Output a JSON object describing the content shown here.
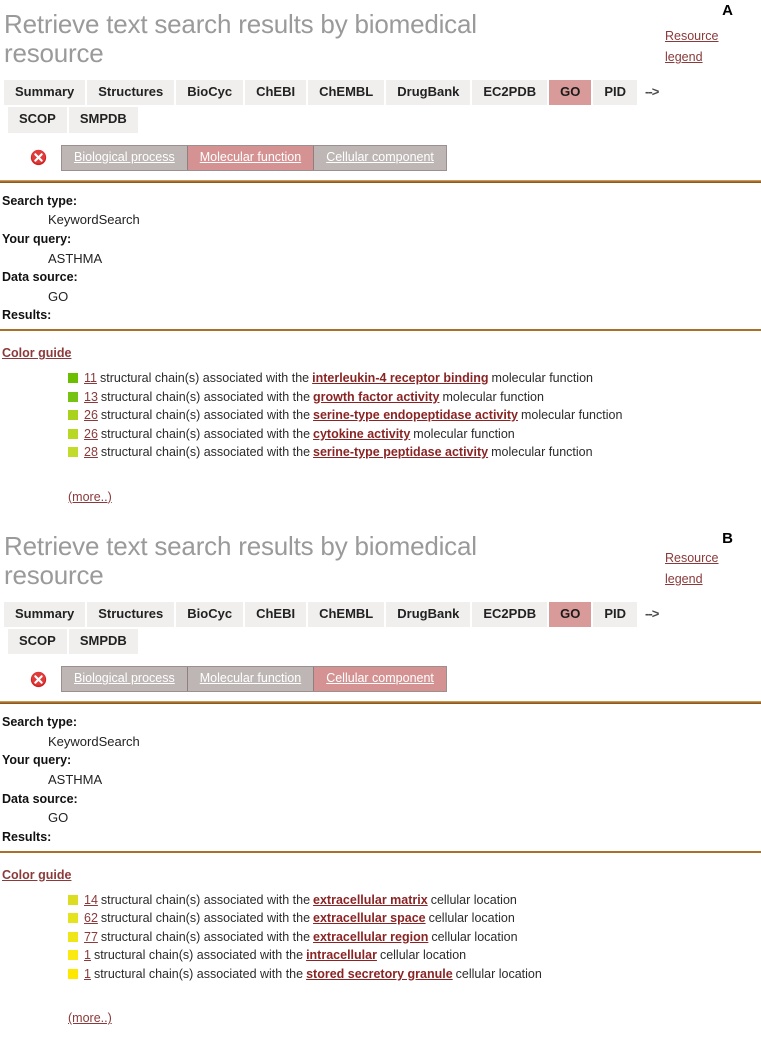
{
  "panels": [
    {
      "letter": "A",
      "title": "Retrieve text search results by biomedical resource",
      "resource_legend": {
        "line1": "Resource",
        "line2": "legend"
      },
      "resource_tabs": {
        "row1": [
          "Summary",
          "Structures",
          "BioCyc",
          "ChEBI",
          "ChEMBL",
          "DrugBank",
          "EC2PDB",
          "GO",
          "PID"
        ],
        "row2": [
          "SCOP",
          "SMPDB"
        ],
        "active": "GO",
        "arrow": "-->"
      },
      "subtabs": {
        "items": [
          "Biological process",
          "Molecular function",
          "Cellular component"
        ],
        "active": "Molecular function",
        "close_icon": "close-circle-icon"
      },
      "meta": {
        "search_type_label": "Search type:",
        "search_type_value": "KeywordSearch",
        "query_label": "Your query:",
        "query_value": "ASTHMA",
        "data_source_label": "Data source:",
        "data_source_value": "GO",
        "results_label": "Results:"
      },
      "color_guide_label": "Color guide",
      "results": [
        {
          "count": "11",
          "mid": "structural chain(s) associated with the",
          "term": "interleukin-4 receptor binding",
          "tail": "molecular function",
          "color": "#6cbf00"
        },
        {
          "count": "13",
          "mid": "structural chain(s) associated with the",
          "term": "growth factor activity",
          "tail": "molecular function",
          "color": "#76c411"
        },
        {
          "count": "26",
          "mid": "structural chain(s) associated with the",
          "term": "serine-type endopeptidase activity",
          "tail": "molecular function",
          "color": "#a8d21c"
        },
        {
          "count": "26",
          "mid": "structural chain(s) associated with the",
          "term": "cytokine activity",
          "tail": "molecular function",
          "color": "#b8d823"
        },
        {
          "count": "28",
          "mid": "structural chain(s) associated with the",
          "term": "serine-type peptidase activity",
          "tail": "molecular function",
          "color": "#c3dc2b"
        }
      ],
      "more_label": "(more..)"
    },
    {
      "letter": "B",
      "title": "Retrieve text search results by biomedical resource",
      "resource_legend": {
        "line1": "Resource",
        "line2": "legend"
      },
      "resource_tabs": {
        "row1": [
          "Summary",
          "Structures",
          "BioCyc",
          "ChEBI",
          "ChEMBL",
          "DrugBank",
          "EC2PDB",
          "GO",
          "PID"
        ],
        "row2": [
          "SCOP",
          "SMPDB"
        ],
        "active": "GO",
        "arrow": "-->"
      },
      "subtabs": {
        "items": [
          "Biological process",
          "Molecular function",
          "Cellular component"
        ],
        "active": "Cellular component",
        "close_icon": "close-circle-icon"
      },
      "meta": {
        "search_type_label": "Search type:",
        "search_type_value": "KeywordSearch",
        "query_label": "Your query:",
        "query_value": "ASTHMA",
        "data_source_label": "Data source:",
        "data_source_value": "GO",
        "results_label": "Results:"
      },
      "color_guide_label": "Color guide",
      "results": [
        {
          "count": "14",
          "mid": "structural chain(s) associated with the",
          "term": "extracellular matrix",
          "tail": "cellular location",
          "color": "#dcdd20"
        },
        {
          "count": "62",
          "mid": "structural chain(s) associated with the",
          "term": "extracellular space",
          "tail": "cellular location",
          "color": "#e5e21e"
        },
        {
          "count": "77",
          "mid": "structural chain(s) associated with the",
          "term": "extracellular region",
          "tail": "cellular location",
          "color": "#efe61a"
        },
        {
          "count": "1",
          "mid": "structural chain(s) associated with the",
          "term": "intracellular",
          "tail": "cellular location",
          "color": "#fbe912"
        },
        {
          "count": "1",
          "mid": "structural chain(s) associated with the",
          "term": "stored secretory granule",
          "tail": "cellular location",
          "color": "#ffe800"
        }
      ],
      "more_label": "(more..)"
    }
  ]
}
